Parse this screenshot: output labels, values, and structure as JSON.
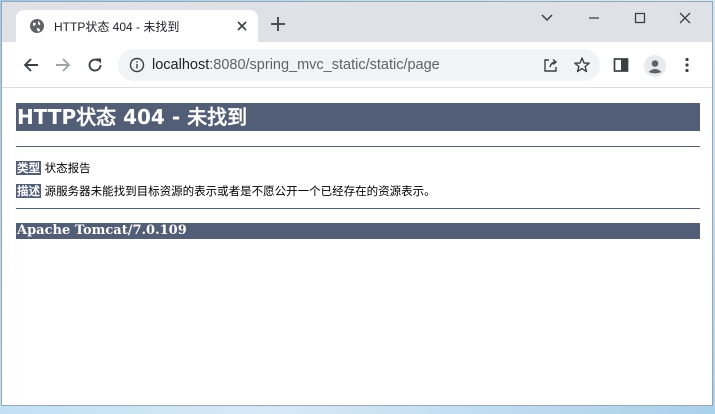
{
  "browser": {
    "tab_title": "HTTP状态 404 - 未找到",
    "url_host": "localhost",
    "url_rest": ":8080/spring_mvc_static/static/page"
  },
  "page": {
    "heading": "HTTP状态 404 - 未找到",
    "type_label": "类型",
    "type_value": "状态报告",
    "desc_label": "描述",
    "desc_value": "源服务器未能找到目标资源的表示或者是不愿公开一个已经存在的资源表示。",
    "footer": "Apache Tomcat/7.0.109"
  },
  "colors": {
    "tomcat_header": "#525d76",
    "tab_strip": "#dee1e6",
    "omnibox": "#f1f3f4"
  }
}
